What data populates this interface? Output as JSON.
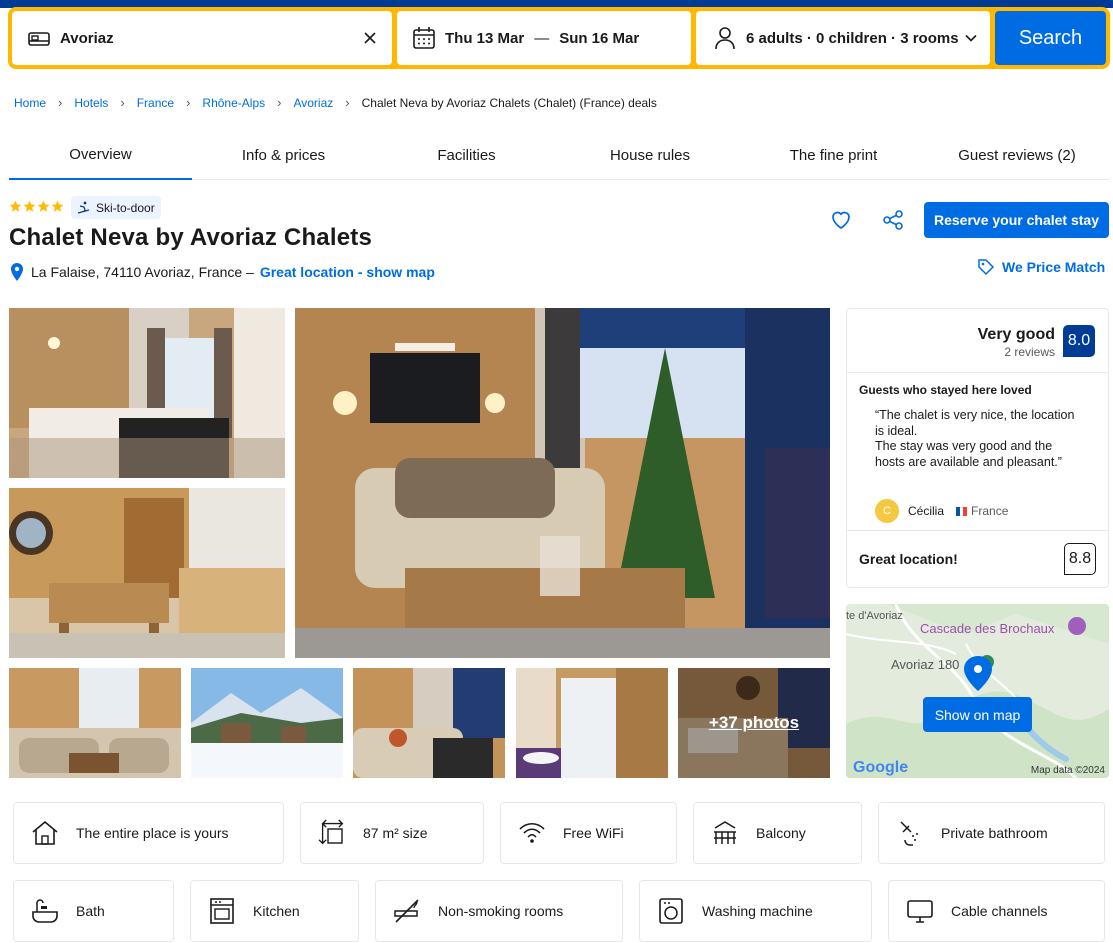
{
  "search": {
    "destination": "Avoriaz",
    "checkin": "Thu 13 Mar",
    "separator": "—",
    "checkout": "Sun 16 Mar",
    "guests": "6 adults · 0 children · 3 rooms",
    "search_label": "Search"
  },
  "breadcrumbs": [
    "Home",
    "Hotels",
    "France",
    "Rhône-Alps",
    "Avoriaz",
    "Chalet Neva by Avoriaz Chalets (Chalet) (France) deals"
  ],
  "tabs": [
    "Overview",
    "Info & prices",
    "Facilities",
    "House rules",
    "The fine print",
    "Guest reviews (2)"
  ],
  "property": {
    "stars": 4,
    "badge": "Ski-to-door",
    "name": "Chalet Neva by Avoriaz Chalets",
    "address": "La Falaise, 74110 Avoriaz, France –",
    "location_link": "Great location - show map",
    "reserve_label": "Reserve your chalet stay",
    "price_match": "We Price Match"
  },
  "gallery": {
    "more_photos": "+37 photos"
  },
  "review": {
    "label": "Very good",
    "count": "2 reviews",
    "score": "8.0",
    "loved_heading": "Guests who stayed here loved",
    "quote": "“The chalet is very nice, the location is ideal.\nThe stay was very good and the hosts are available and pleasant.”",
    "reviewer_initial": "C",
    "reviewer_name": "Cécilia",
    "reviewer_country": "France",
    "location_label": "Great location!",
    "location_score": "8.8"
  },
  "map": {
    "label_top": "te d'Avoriaz",
    "label_poi": "Cascade des Brochaux",
    "label_town": "Avoriaz 180",
    "button": "Show on map",
    "google": "Google",
    "attribution": "Map data ©2024"
  },
  "facilities": [
    {
      "label": "The entire place is yours",
      "icon": "house-icon"
    },
    {
      "label": "87 m² size",
      "icon": "size-icon"
    },
    {
      "label": "Free WiFi",
      "icon": "wifi-icon"
    },
    {
      "label": "Balcony",
      "icon": "balcony-icon"
    },
    {
      "label": "Private bathroom",
      "icon": "shower-icon"
    },
    {
      "label": "Bath",
      "icon": "bath-icon"
    },
    {
      "label": "Kitchen",
      "icon": "kitchen-icon"
    },
    {
      "label": "Non-smoking rooms",
      "icon": "no-smoking-icon"
    },
    {
      "label": "Washing machine",
      "icon": "washing-machine-icon"
    },
    {
      "label": "Cable channels",
      "icon": "tv-icon"
    }
  ],
  "colors": {
    "brand_blue": "#006ce4",
    "dark_blue": "#003b95",
    "search_yellow": "#ffb700",
    "star_yellow": "#febb02"
  }
}
